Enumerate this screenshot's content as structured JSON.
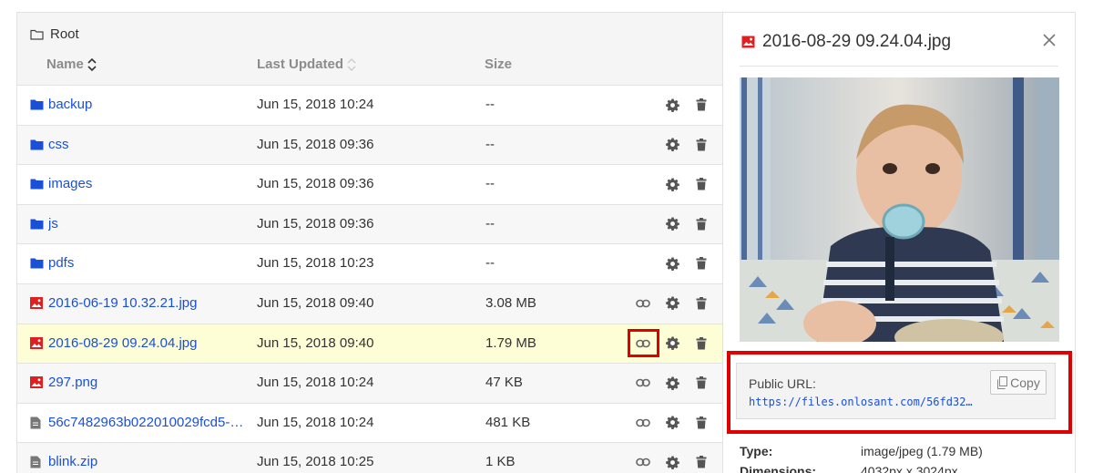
{
  "breadcrumb": {
    "label": "Root"
  },
  "columns": {
    "name": "Name",
    "updated": "Last Updated",
    "size": "Size"
  },
  "files": [
    {
      "name": "backup",
      "updated": "Jun 15, 2018 10:24",
      "size": "--",
      "type": "folder"
    },
    {
      "name": "css",
      "updated": "Jun 15, 2018 09:36",
      "size": "--",
      "type": "folder"
    },
    {
      "name": "images",
      "updated": "Jun 15, 2018 09:36",
      "size": "--",
      "type": "folder"
    },
    {
      "name": "js",
      "updated": "Jun 15, 2018 09:36",
      "size": "--",
      "type": "folder"
    },
    {
      "name": "pdfs",
      "updated": "Jun 15, 2018 10:23",
      "size": "--",
      "type": "folder"
    },
    {
      "name": "2016-06-19 10.32.21.jpg",
      "updated": "Jun 15, 2018 09:40",
      "size": "3.08 MB",
      "type": "image"
    },
    {
      "name": "2016-08-29 09.24.04.jpg",
      "updated": "Jun 15, 2018 09:40",
      "size": "1.79 MB",
      "type": "image",
      "selected": true
    },
    {
      "name": "297.png",
      "updated": "Jun 15, 2018 10:24",
      "size": "47 KB",
      "type": "image"
    },
    {
      "name": "56c7482963b022010029fcd5-5…",
      "updated": "Jun 15, 2018 10:24",
      "size": "481 KB",
      "type": "file"
    },
    {
      "name": "blink.zip",
      "updated": "Jun 15, 2018 10:25",
      "size": "1 KB",
      "type": "file"
    }
  ],
  "preview": {
    "title": "2016-08-29 09.24.04.jpg",
    "public_url_label": "Public URL:",
    "public_url": "https://files.onlosant.com/56fd32…",
    "copy_label": "Copy",
    "meta": [
      {
        "key": "Type:",
        "value": "image/jpeg (1.79 MB)"
      },
      {
        "key": "Dimensions:",
        "value": "4032px x 3024px"
      }
    ]
  },
  "colors": {
    "link": "#1a4fd8",
    "folder_icon": "#1a4fd8",
    "image_icon": "#e02020",
    "highlight": "#e00000",
    "selected_row": "#fdfdd6"
  },
  "icons": {
    "folder": "folder-icon",
    "image": "image-file-icon",
    "file": "document-icon",
    "link": "link-icon",
    "gear": "gear-icon",
    "trash": "trash-icon",
    "sort": "sort-icon",
    "close": "close-icon",
    "copy": "copy-icon"
  }
}
